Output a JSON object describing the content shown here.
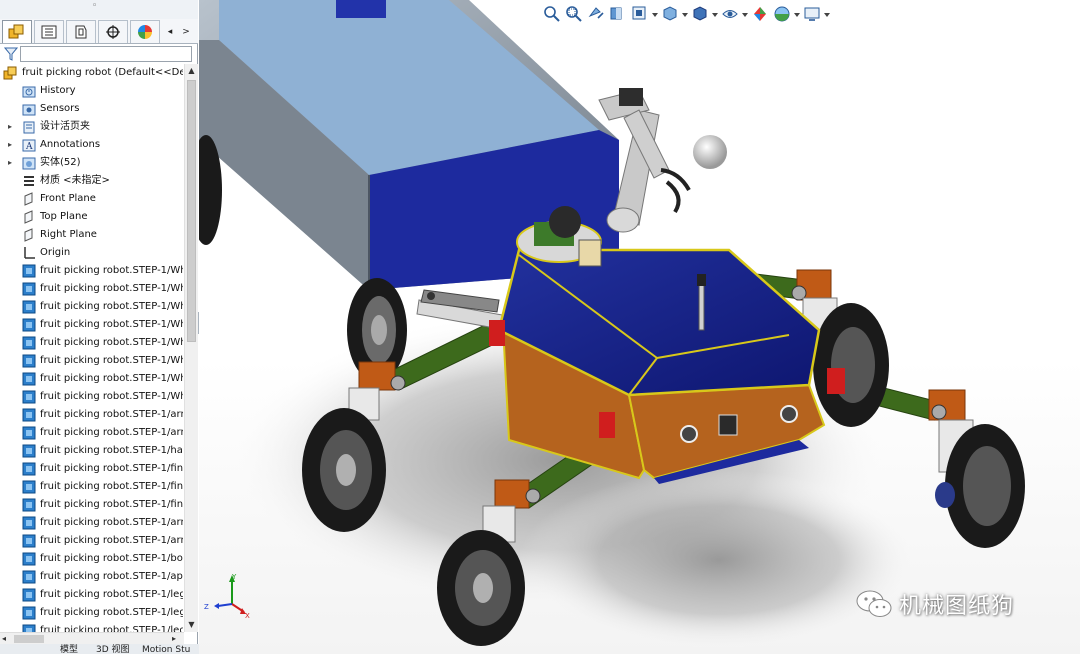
{
  "feature_manager": {
    "tabs": [
      {
        "name": "feature-manager-tab",
        "icon": "feature-tree-icon",
        "active": true
      },
      {
        "name": "property-manager-tab",
        "icon": "property-list-icon",
        "active": false
      },
      {
        "name": "configuration-manager-tab",
        "icon": "configuration-icon",
        "active": false
      },
      {
        "name": "dimxpert-manager-tab",
        "icon": "crosshair-icon",
        "active": false
      },
      {
        "name": "display-manager-tab",
        "icon": "appearance-pie-icon",
        "active": false
      }
    ],
    "tab_scroll_left": "◂",
    "tab_scroll_right": ">",
    "filter_icon": "filter-icon",
    "root": {
      "label": "fruit picking robot  (Default<<Def",
      "icon": "assembly-icon"
    },
    "items": [
      {
        "label": "History",
        "icon": "history-folder-icon",
        "expand": ""
      },
      {
        "label": "Sensors",
        "icon": "sensors-folder-icon",
        "expand": ""
      },
      {
        "label": "设计活页夹",
        "icon": "design-binder-icon",
        "expand": "▸"
      },
      {
        "label": "Annotations",
        "icon": "annotations-icon",
        "expand": "▸"
      },
      {
        "label": "实体(52)",
        "icon": "solid-bodies-icon",
        "expand": "▸"
      },
      {
        "label": "材质 <未指定>",
        "icon": "material-icon",
        "expand": ""
      },
      {
        "label": "Front Plane",
        "icon": "plane-icon",
        "expand": ""
      },
      {
        "label": "Top Plane",
        "icon": "plane-icon",
        "expand": ""
      },
      {
        "label": "Right Plane",
        "icon": "plane-icon",
        "expand": ""
      },
      {
        "label": "Origin",
        "icon": "origin-icon",
        "expand": ""
      },
      {
        "label": "fruit picking robot.STEP-1/Wh",
        "icon": "part-icon",
        "expand": ""
      },
      {
        "label": "fruit picking robot.STEP-1/Wh",
        "icon": "part-icon",
        "expand": ""
      },
      {
        "label": "fruit picking robot.STEP-1/Wh",
        "icon": "part-icon",
        "expand": ""
      },
      {
        "label": "fruit picking robot.STEP-1/Wh",
        "icon": "part-icon",
        "expand": ""
      },
      {
        "label": "fruit picking robot.STEP-1/Wh",
        "icon": "part-icon",
        "expand": ""
      },
      {
        "label": "fruit picking robot.STEP-1/Wh",
        "icon": "part-icon",
        "expand": ""
      },
      {
        "label": "fruit picking robot.STEP-1/Wh",
        "icon": "part-icon",
        "expand": ""
      },
      {
        "label": "fruit picking robot.STEP-1/Wh",
        "icon": "part-icon",
        "expand": ""
      },
      {
        "label": "fruit picking robot.STEP-1/arm",
        "icon": "part-icon",
        "expand": ""
      },
      {
        "label": "fruit picking robot.STEP-1/arm",
        "icon": "part-icon",
        "expand": ""
      },
      {
        "label": "fruit picking robot.STEP-1/han",
        "icon": "part-icon",
        "expand": ""
      },
      {
        "label": "fruit picking robot.STEP-1/fing",
        "icon": "part-icon",
        "expand": ""
      },
      {
        "label": "fruit picking robot.STEP-1/fing",
        "icon": "part-icon",
        "expand": ""
      },
      {
        "label": "fruit picking robot.STEP-1/fing",
        "icon": "part-icon",
        "expand": ""
      },
      {
        "label": "fruit picking robot.STEP-1/arm",
        "icon": "part-icon",
        "expand": ""
      },
      {
        "label": "fruit picking robot.STEP-1/arm",
        "icon": "part-icon",
        "expand": ""
      },
      {
        "label": "fruit picking robot.STEP-1/bod",
        "icon": "part-icon",
        "expand": ""
      },
      {
        "label": "fruit picking robot.STEP-1/apr",
        "icon": "part-icon",
        "expand": ""
      },
      {
        "label": "fruit picking robot.STEP-1/leg.",
        "icon": "part-icon",
        "expand": ""
      },
      {
        "label": "fruit picking robot.STEP-1/leg",
        "icon": "part-icon",
        "expand": ""
      },
      {
        "label": "fruit picking robot.STEP-1/leg",
        "icon": "part-icon",
        "expand": ""
      }
    ],
    "bottom_tabs": [
      "模型",
      "3D 视图",
      "Motion Stu"
    ]
  },
  "heads_up_toolbar": [
    {
      "name": "zoom-to-fit-icon",
      "group_end": false
    },
    {
      "name": "zoom-to-area-icon",
      "group_end": false
    },
    {
      "name": "previous-view-icon",
      "group_end": false
    },
    {
      "name": "section-view-icon",
      "group_end": false
    },
    {
      "name": "dynamic-annotation-icon",
      "group_end": true
    },
    {
      "name": "view-orientation-icon",
      "group_end": true
    },
    {
      "name": "display-style-icon",
      "group_end": true
    },
    {
      "name": "hide-show-items-icon",
      "group_end": true
    },
    {
      "name": "edit-appearance-icon",
      "group_end": false
    },
    {
      "name": "apply-scene-icon",
      "group_end": true
    },
    {
      "name": "view-settings-icon",
      "group_end": true
    }
  ],
  "colors": {
    "chassis_blue": "#1d2a9e",
    "tray_grey": "#7f8a96",
    "tray_inner": "#8fb1d4",
    "leg_green": "#3d6a1c",
    "joint_orange": "#c05a16",
    "bracket_red": "#d01e1e",
    "trim_yellow": "#d8c81a",
    "tire_black": "#1a1a1a",
    "arm_grey": "#c9c9c9",
    "band_orange": "#b5631e"
  },
  "triad": {
    "x_label": "X",
    "y_label": "Y",
    "z_label": "Z"
  },
  "watermark": {
    "text": "机械图纸狗",
    "logo": "wechat-logo-icon"
  }
}
